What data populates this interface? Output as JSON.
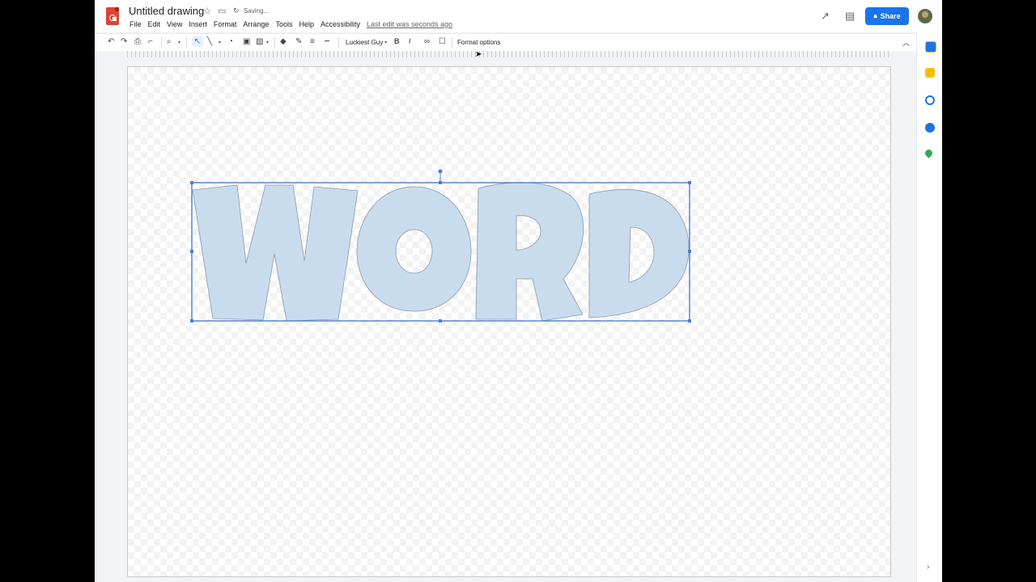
{
  "header": {
    "title": "Untitled drawing",
    "saving": "Saving...",
    "menu": [
      "File",
      "Edit",
      "View",
      "Insert",
      "Format",
      "Arrange",
      "Tools",
      "Help",
      "Accessibility"
    ],
    "last_edit": "Last edit was seconds ago",
    "share_label": "Share"
  },
  "toolbar": {
    "font": "Luckiest Guy",
    "format_options": "Format options",
    "bold": "B",
    "italic": "I"
  },
  "canvas": {
    "word_text": "WORD",
    "fill_color": "#c9dcee",
    "selection_color": "#4a7fd0"
  },
  "colors": {
    "accent": "#1a73e8",
    "logo": "#db4437"
  }
}
